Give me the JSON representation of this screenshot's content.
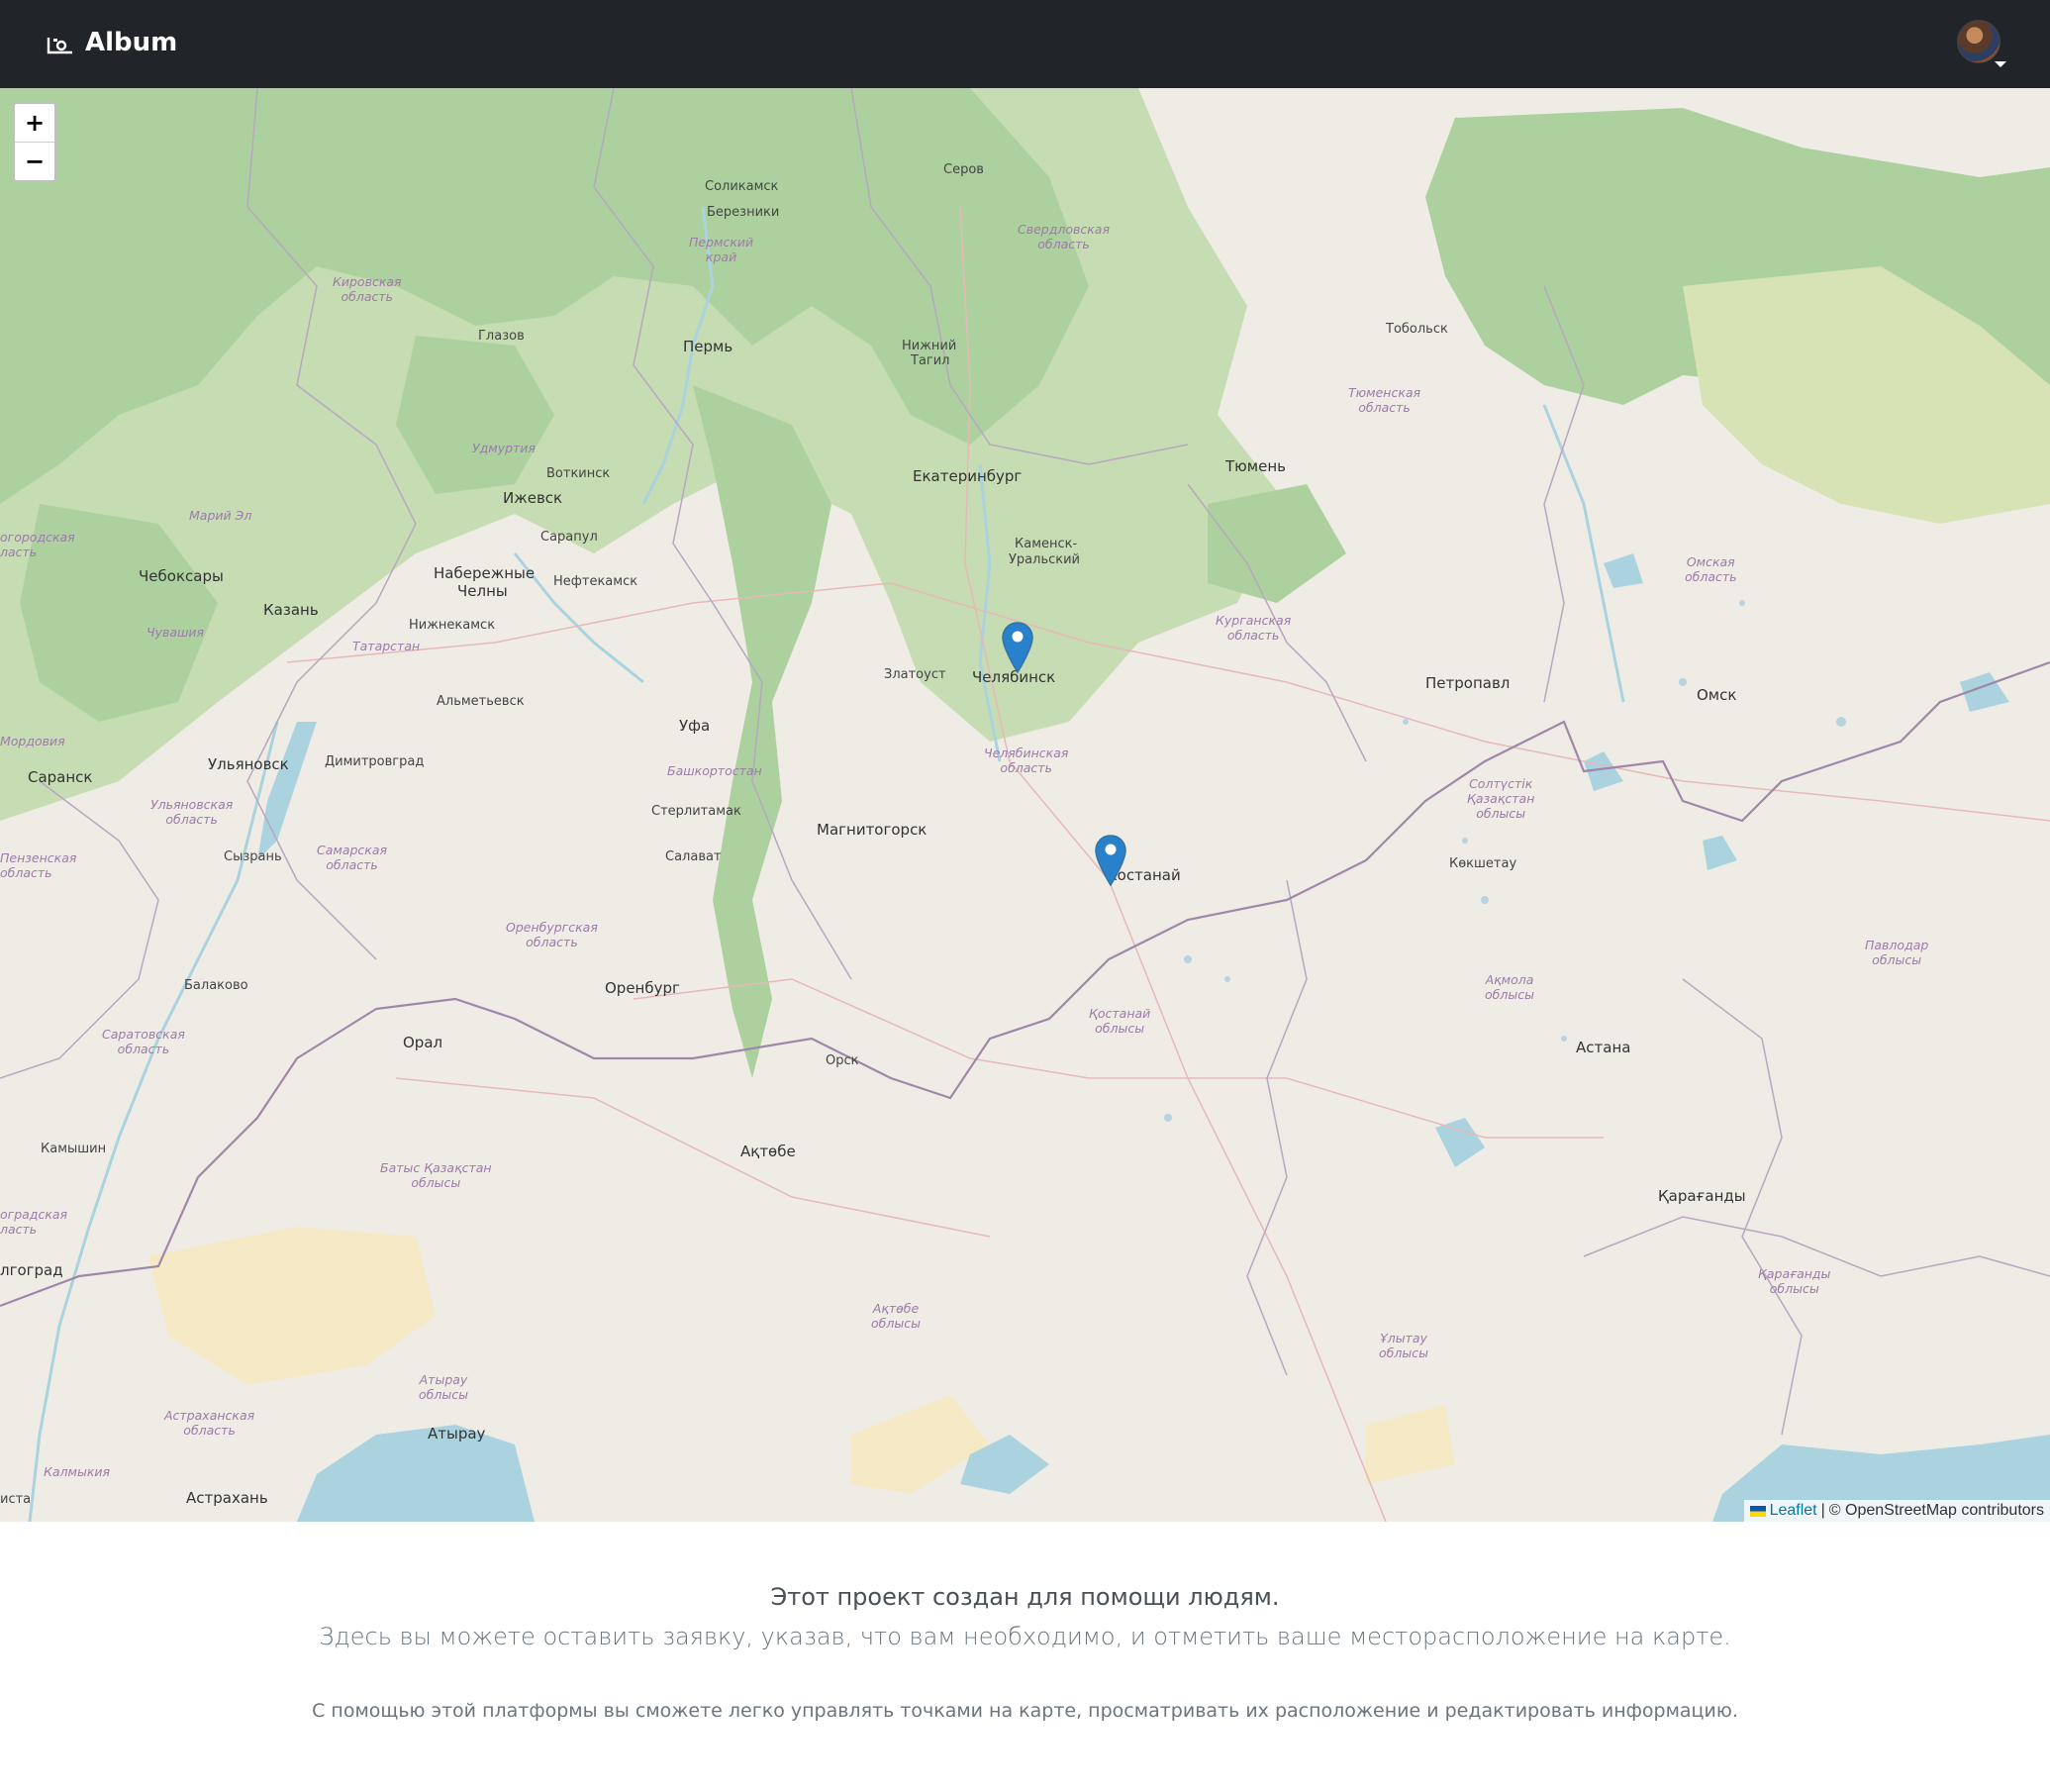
{
  "navbar": {
    "brand": "Album",
    "brand_icon": "camera-icon",
    "user_menu_icon": "user-avatar"
  },
  "map": {
    "zoom_in": "+",
    "zoom_out": "−",
    "attribution": {
      "leaflet": "Leaflet",
      "separator": "|",
      "osm": "© OpenStreetMap contributors"
    },
    "cities": {
      "solikamsk": "Соликамск",
      "berezniki": "Березники",
      "serov": "Серов",
      "glazov": "Глазов",
      "perm": "Пермь",
      "nizhny_tagil_1": "Нижний",
      "nizhny_tagil_2": "Тагил",
      "tobolsk": "Тобольск",
      "votkinsk": "Воткинск",
      "izhevsk": "Ижевск",
      "ekaterinburg": "Екатеринбург",
      "tyumen": "Тюмень",
      "sarapul": "Сарапул",
      "kamensk_1": "Каменск-",
      "kamensk_2": "Уральский",
      "cheboksary": "Чебоксары",
      "chelny_1": "Набережные",
      "chelny_2": "Челны",
      "neftekamsk": "Нефтекамск",
      "kazan": "Казань",
      "nizhnekamsk": "Нижнекамск",
      "zlatoust": "Златоуст",
      "chelyabinsk": "Челябинск",
      "petropavl": "Петропавл",
      "omsk": "Омск",
      "almetyevsk": "Альметьевск",
      "ufa": "Уфа",
      "saransk": "Саранск",
      "ulyanovsk": "Ульяновск",
      "dimitrovgrad": "Димитровград",
      "sterlitamak": "Стерлитамак",
      "magnitogorsk": "Магнитогорск",
      "syzran": "Сызрань",
      "salavat": "Салават",
      "kokshetau": "Көкшетау",
      "kostanay": "Костанай",
      "balakovo": "Балаково",
      "orenburg": "Оренбург",
      "oral": "Орал",
      "orsk": "Орск",
      "astana": "Астана",
      "kamyshin": "Камышин",
      "aktobe": "Ақтөбе",
      "karaganda": "Қарағанды",
      "volgograd": "лгоград",
      "atyrau": "Атырау",
      "astrakhan": "Астрахань",
      "elista": "иста"
    },
    "regions": {
      "perm_krai_1": "Пермский",
      "perm_krai_2": "край",
      "sverdlovsk_1": "Свердловская",
      "sverdlovsk_2": "область",
      "kirov_1": "Кировская",
      "kirov_2": "область",
      "tyumen_1": "Тюменская",
      "tyumen_2": "область",
      "udmurtia": "Удмуртия",
      "mari_el": "Марий Эл",
      "omsk_1": "Омская",
      "omsk_2": "область",
      "nizh_1": "огородская",
      "nizh_2": "ласть",
      "kurgan_1": "Курганская",
      "kurgan_2": "область",
      "chuvashia": "Чувашия",
      "tatarstan": "Татарстан",
      "mordovia": "Мордовия",
      "bashkortostan": "Башкортостан",
      "chelyabinsk_1": "Челябинская",
      "chelyabinsk_2": "область",
      "nko_1": "Солтүстік",
      "nko_2": "Қазақстан",
      "nko_3": "облысы",
      "ulyanovsk_1": "Ульяновская",
      "ulyanovsk_2": "область",
      "penza_1": "Пензенская",
      "penza_2": "область",
      "samara_1": "Самарская",
      "samara_2": "область",
      "orenburg_1": "Оренбургская",
      "orenburg_2": "область",
      "pavlodar_1": "Павлодар",
      "pavlodar_2": "облысы",
      "akmola_1": "Ақмола",
      "akmola_2": "облысы",
      "kostanay_1": "Қостанай",
      "kostanay_2": "облысы",
      "saratov_1": "Саратовская",
      "saratov_2": "область",
      "wko_1": "Батыс Қазақстан",
      "wko_2": "облысы",
      "volg_1": "оградская",
      "volg_2": "ласть",
      "karaganda_1": "Қарағанды",
      "karaganda_2": "облысы",
      "aktobe_1": "Ақтөбе",
      "aktobe_2": "облысы",
      "ulytau_1": "Ұлытау",
      "ulytau_2": "облысы",
      "atyrau_1": "Атырау",
      "atyrau_2": "облысы",
      "astrakhan_1": "Астраханская",
      "astrakhan_2": "область",
      "kalmykia": "Калмыкия"
    },
    "markers": [
      {
        "name": "Челябинск"
      },
      {
        "name": "Костанай"
      }
    ]
  },
  "content": {
    "headline": "Этот проект создан для помощи людям.",
    "lead": "Здесь вы можете оставить заявку, указав, что вам необходимо, и отметить ваше месторасположение на карте.",
    "note": "С помощью этой платформы вы сможете легко управлять точками на карте, просматривать их расположение и редактировать информацию."
  },
  "colors": {
    "navbar": "#212529",
    "forest": "#add19e",
    "land": "#efece6",
    "water": "#aad3df",
    "border": "#9e87a8",
    "marker": "#2a81cb"
  }
}
